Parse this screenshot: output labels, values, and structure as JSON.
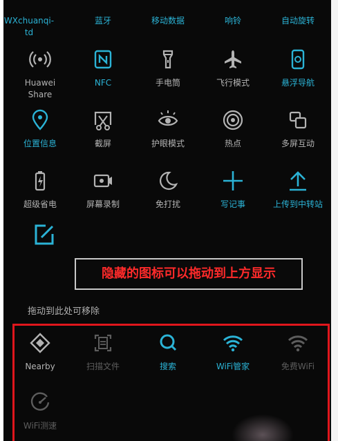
{
  "colors": {
    "accent": "#2bb3d6",
    "text": "#b3b3b3",
    "dim": "#5d5d5d",
    "banner_text": "#ff2a2a",
    "highlight_box": "#e0161c"
  },
  "top_row": [
    {
      "label": "WXchuanqi-",
      "label2": "td",
      "active": true
    },
    {
      "label": "蓝牙",
      "active": true
    },
    {
      "label": "移动数据",
      "active": true
    },
    {
      "label": "响铃",
      "active": true
    },
    {
      "label": "自动旋转",
      "active": true
    }
  ],
  "row1": [
    {
      "label": "Huawei",
      "label2": "Share",
      "icon": "huawei-share-icon",
      "active": false
    },
    {
      "label": "NFC",
      "icon": "nfc-icon",
      "active": true
    },
    {
      "label": "手电筒",
      "icon": "flashlight-icon",
      "active": false
    },
    {
      "label": "飞行模式",
      "icon": "airplane-icon",
      "active": false
    },
    {
      "label": "悬浮导航",
      "icon": "floating-nav-icon",
      "active": true
    }
  ],
  "row2": [
    {
      "label": "位置信息",
      "icon": "location-icon",
      "active": true
    },
    {
      "label": "截屏",
      "icon": "screenshot-icon",
      "active": false
    },
    {
      "label": "护眼模式",
      "icon": "eye-icon",
      "active": false
    },
    {
      "label": "热点",
      "icon": "hotspot-icon",
      "active": false
    },
    {
      "label": "多屏互动",
      "icon": "multiscreen-icon",
      "active": false
    }
  ],
  "row3": [
    {
      "label": "超级省电",
      "icon": "battery-icon",
      "active": false
    },
    {
      "label": "屏幕录制",
      "icon": "screen-record-icon",
      "active": false
    },
    {
      "label": "免打扰",
      "icon": "moon-icon",
      "active": false
    },
    {
      "label": "写记事",
      "icon": "plus-icon",
      "active": true
    },
    {
      "label": "上传到中转站",
      "icon": "upload-icon",
      "active": true
    }
  ],
  "edit_icon": "edit-icon",
  "banner": "隐藏的图标可以拖动到上方显示",
  "remove_hint": "拖动到此处可移除",
  "hidden": [
    {
      "label": "Nearby",
      "icon": "nearby-icon",
      "state": "normal"
    },
    {
      "label": "扫描文件",
      "icon": "scan-file-icon",
      "state": "dim"
    },
    {
      "label": "搜索",
      "icon": "search-icon",
      "state": "blue"
    },
    {
      "label": "WiFi管家",
      "icon": "wifi-icon",
      "state": "blue"
    },
    {
      "label": "免费WiFi",
      "icon": "wifi-icon",
      "state": "dim"
    },
    {
      "label": "WiFi测速",
      "icon": "speedometer-icon",
      "state": "dim"
    }
  ]
}
